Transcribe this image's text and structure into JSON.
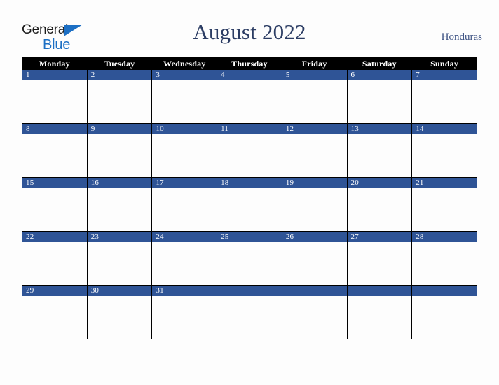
{
  "logo": {
    "word_one": "General",
    "word_two": "Blue",
    "triangle_icon": "triangle-icon",
    "brand_blue": "#1c6fc4",
    "brand_dark": "#1b1b1b"
  },
  "header": {
    "title": "August 2022",
    "country": "Honduras",
    "title_color": "#2b3c63",
    "country_color": "#3f5484"
  },
  "calendar": {
    "accent_color": "#2f5496",
    "header_bg": "#000000",
    "header_fg": "#ffffff",
    "weekday_headers": [
      "Monday",
      "Tuesday",
      "Wednesday",
      "Thursday",
      "Friday",
      "Saturday",
      "Sunday"
    ],
    "weeks": [
      [
        {
          "day": "1"
        },
        {
          "day": "2"
        },
        {
          "day": "3"
        },
        {
          "day": "4"
        },
        {
          "day": "5"
        },
        {
          "day": "6"
        },
        {
          "day": "7"
        }
      ],
      [
        {
          "day": "8"
        },
        {
          "day": "9"
        },
        {
          "day": "10"
        },
        {
          "day": "11"
        },
        {
          "day": "12"
        },
        {
          "day": "13"
        },
        {
          "day": "14"
        }
      ],
      [
        {
          "day": "15"
        },
        {
          "day": "16"
        },
        {
          "day": "17"
        },
        {
          "day": "18"
        },
        {
          "day": "19"
        },
        {
          "day": "20"
        },
        {
          "day": "21"
        }
      ],
      [
        {
          "day": "22"
        },
        {
          "day": "23"
        },
        {
          "day": "24"
        },
        {
          "day": "25"
        },
        {
          "day": "26"
        },
        {
          "day": "27"
        },
        {
          "day": "28"
        }
      ],
      [
        {
          "day": "29"
        },
        {
          "day": "30"
        },
        {
          "day": "31"
        },
        {
          "day": ""
        },
        {
          "day": ""
        },
        {
          "day": ""
        },
        {
          "day": ""
        }
      ]
    ]
  }
}
